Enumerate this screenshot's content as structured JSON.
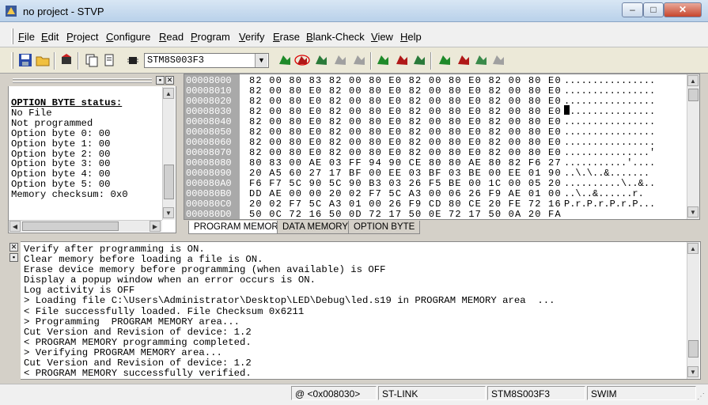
{
  "window": {
    "title": "no project - STVP"
  },
  "menu": [
    "File",
    "Edit",
    "Project",
    "Configure",
    "Read",
    "Program",
    "Verify",
    "Erase",
    "Blank-Check",
    "View",
    "Help"
  ],
  "toolbar": {
    "device": "STM8S003F3"
  },
  "option_panel": {
    "title": "OPTION BYTE status:",
    "lines": [
      "No File",
      "Not programmed",
      "Option byte 0: 00",
      "Option byte 1: 00",
      "Option byte 2: 00",
      "Option byte 3: 00",
      "Option byte 4: 00",
      "Option byte 5: 00",
      "Memory checksum: 0x0"
    ]
  },
  "hex": {
    "addresses": [
      "00008000",
      "00008010",
      "00008020",
      "00008030",
      "00008040",
      "00008050",
      "00008060",
      "00008070",
      "00008080",
      "00008090",
      "000080A0",
      "000080B0",
      "000080C0",
      "000080D0"
    ],
    "rows": [
      "82 00 80 83 82 00 80 E0 82 00 80 E0 82 00 80 E0",
      "82 00 80 E0 82 00 80 E0 82 00 80 E0 82 00 80 E0",
      "82 00 80 E0 82 00 80 E0 82 00 80 E0 82 00 80 E0",
      "82 00 80 E0 82 00 80 E0 82 00 80 E0 82 00 80 E0",
      "82 00 80 E0 82 00 80 E0 82 00 80 E0 82 00 80 E0",
      "82 00 80 E0 82 00 80 E0 82 00 80 E0 82 00 80 E0",
      "82 00 80 E0 82 00 80 E0 82 00 80 E0 82 00 80 E0",
      "82 00 80 E0 82 00 80 E0 82 00 80 E0 82 00 80 E0",
      "80 83 00 AE 03 FF 94 90 CE 80 80 AE 80 82 F6 27",
      "20 A5 60 27 17 BF 00 EE 03 BF 03 BE 00 EE 01 90",
      "F6 F7 5C 90 5C 90 B3 03 26 F5 BE 00 1C 00 05 20",
      "DD AE 00 00 20 02 F7 5C A3 00 06 26 F9 AE 01 00",
      "20 02 F7 5C A3 01 00 26 F9 CD 80 CE 20 FE 72 16",
      "50 0C 72 16 50 0D 72 17 50 0E 72 17 50 0A 20 FA"
    ],
    "ascii": [
      "................",
      "................",
      "................",
      "................",
      "................",
      "................",
      "................",
      "...............'",
      "...........'....",
      "..\\.\\..&.......",
      "..........\\..&..",
      "..\\..&......r.",
      "P.r.P.r.P.r.P...",
      ""
    ]
  },
  "tabs": [
    "PROGRAM MEMORY",
    "DATA MEMORY",
    "OPTION BYTE"
  ],
  "log": [
    "Verify after programming is ON.",
    "Clear memory before loading a file is ON.",
    "Erase device memory before programming (when available) is OFF",
    "Display a popup window when an error occurs is ON.",
    "Log activity is OFF",
    "> Loading file C:\\Users\\Administrator\\Desktop\\LED\\Debug\\led.s19 in PROGRAM MEMORY area  ...",
    "< File successfully loaded. File Checksum 0x6211",
    "> Programming  PROGRAM MEMORY area...",
    "Cut Version and Revision of device: 1.2",
    "< PROGRAM MEMORY programming completed.",
    "> Verifying PROGRAM MEMORY area...",
    "Cut Version and Revision of device: 1.2",
    "< PROGRAM MEMORY successfully verified."
  ],
  "status": {
    "address": "@ <0x008030>",
    "tool": "ST-LINK",
    "device": "STM8S003F3",
    "protocol": "SWIM"
  }
}
